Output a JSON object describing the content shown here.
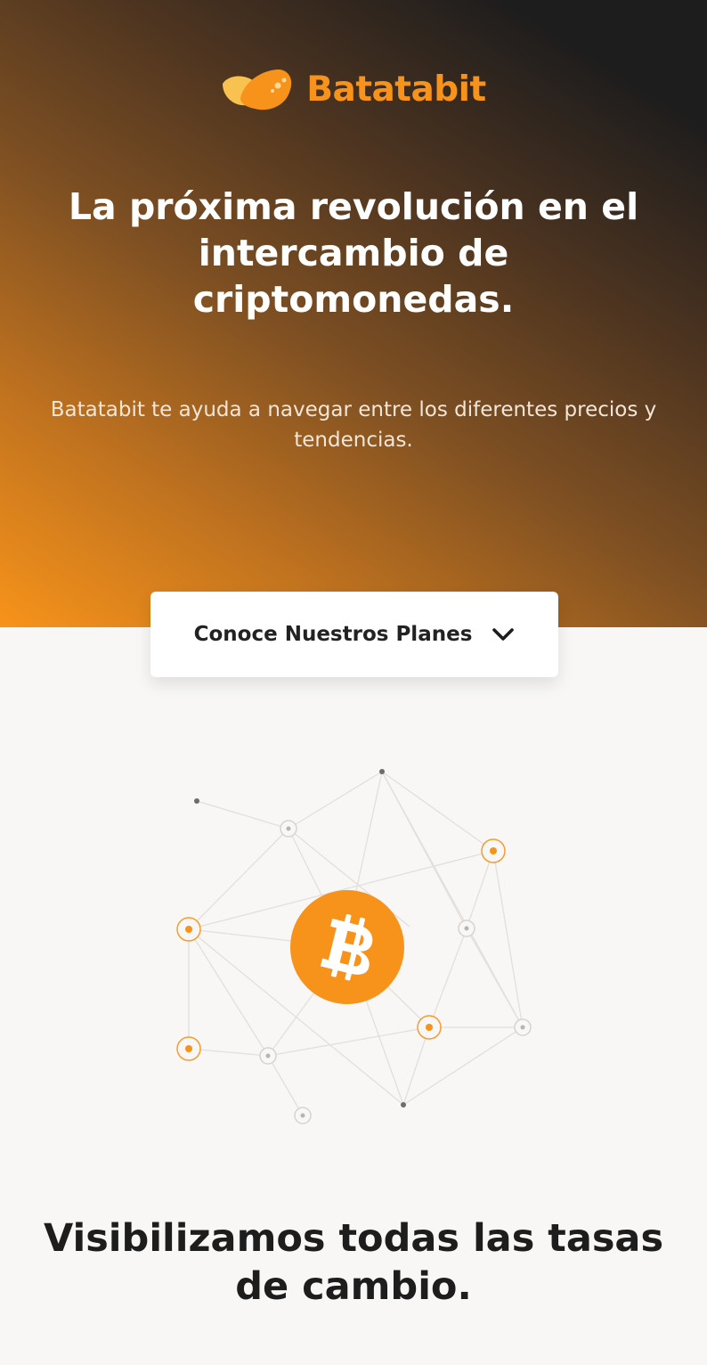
{
  "brand": {
    "name": "Batatabit",
    "logo_icon": "potato-chip-icon",
    "accent_color": "#f7931a"
  },
  "hero": {
    "title": "La próxima revolución en el intercambio de criptomonedas.",
    "subtitle": "Batatabit te ayuda a navegar entre los diferentes precios y tendencias.",
    "gradient_colors": [
      "#1e1d1d",
      "#f7931a"
    ]
  },
  "plans_button": {
    "label": "Conoce Nuestros Planes",
    "icon": "chevron-down-icon"
  },
  "illustration": {
    "center_icon": "bitcoin-icon",
    "node_icons": "network-node-icon"
  },
  "section": {
    "title": "Visibilizamos todas las tasas de cambio."
  }
}
